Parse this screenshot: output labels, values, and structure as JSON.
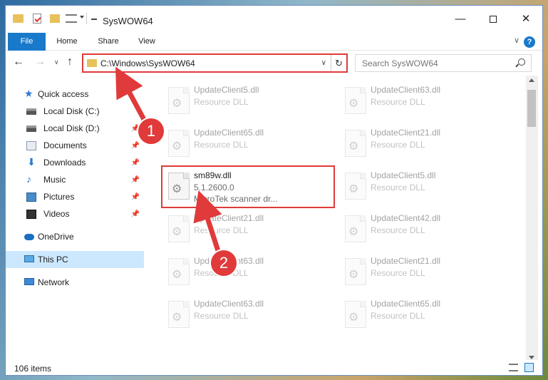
{
  "window": {
    "title": "SysWOW64",
    "minimize": "—",
    "close": "✕"
  },
  "ribbon": {
    "tabs": [
      "File",
      "Home",
      "Share",
      "View"
    ],
    "collapse": "∨",
    "help": "?"
  },
  "nav": {
    "back": "←",
    "forward": "→",
    "recent": "∨",
    "up": "↑",
    "address": "C:\\Windows\\SysWOW64",
    "address_dropdown": "∨",
    "refresh": "↻",
    "search_placeholder": "Search SysWOW64"
  },
  "sidebar": {
    "items": [
      {
        "label": "Quick access",
        "icon": "star-icon"
      },
      {
        "label": "Local Disk (C:)",
        "icon": "disk-icon"
      },
      {
        "label": "Local Disk (D:)",
        "icon": "disk-icon",
        "pinned": true
      },
      {
        "label": "Documents",
        "icon": "documents-icon",
        "pinned": true
      },
      {
        "label": "Downloads",
        "icon": "download-icon",
        "pinned": true
      },
      {
        "label": "Music",
        "icon": "music-icon",
        "pinned": true
      },
      {
        "label": "Pictures",
        "icon": "pictures-icon",
        "pinned": true
      },
      {
        "label": "Videos",
        "icon": "videos-icon",
        "pinned": true
      },
      {
        "label": "OneDrive",
        "icon": "cloud-icon"
      },
      {
        "label": "This PC",
        "icon": "computer-icon",
        "selected": true
      },
      {
        "label": "Network",
        "icon": "network-icon"
      }
    ],
    "pin_glyph": "📌",
    "star_glyph": "★",
    "download_glyph": "⬇",
    "music_glyph": "♪"
  },
  "files": [
    {
      "name": "UpdateClient5.dll",
      "desc": "Resource DLL"
    },
    {
      "name": "UpdateClient63.dll",
      "desc": "Resource DLL"
    },
    {
      "name": "UpdateClient65.dll",
      "desc": "Resource DLL"
    },
    {
      "name": "UpdateClient21.dll",
      "desc": "Resource DLL"
    },
    {
      "name": "sm89w.dll",
      "desc": "5.1.2600.0",
      "desc2": "MicroTek scanner dr...",
      "highlighted": true
    },
    {
      "name": "UpdateClient5.dll",
      "desc": "Resource DLL"
    },
    {
      "name": "UpdateClient21.dll",
      "desc": "Resource DLL"
    },
    {
      "name": "UpdateClient42.dll",
      "desc": "Resource DLL"
    },
    {
      "name": "UpdateClient63.dll",
      "desc": "Resource DLL"
    },
    {
      "name": "UpdateClient21.dll",
      "desc": "Resource DLL"
    },
    {
      "name": "UpdateClient63.dll",
      "desc": "Resource DLL"
    },
    {
      "name": "UpdateClient65.dll",
      "desc": "Resource DLL"
    }
  ],
  "status": {
    "count": "106 items"
  },
  "annotations": [
    {
      "number": "1",
      "target": "address bar"
    },
    {
      "number": "2",
      "target": "sm89w.dll"
    }
  ],
  "colors": {
    "accent": "#1979ca",
    "highlight_box": "#e03a3a",
    "selected_bg": "#cce8ff"
  }
}
